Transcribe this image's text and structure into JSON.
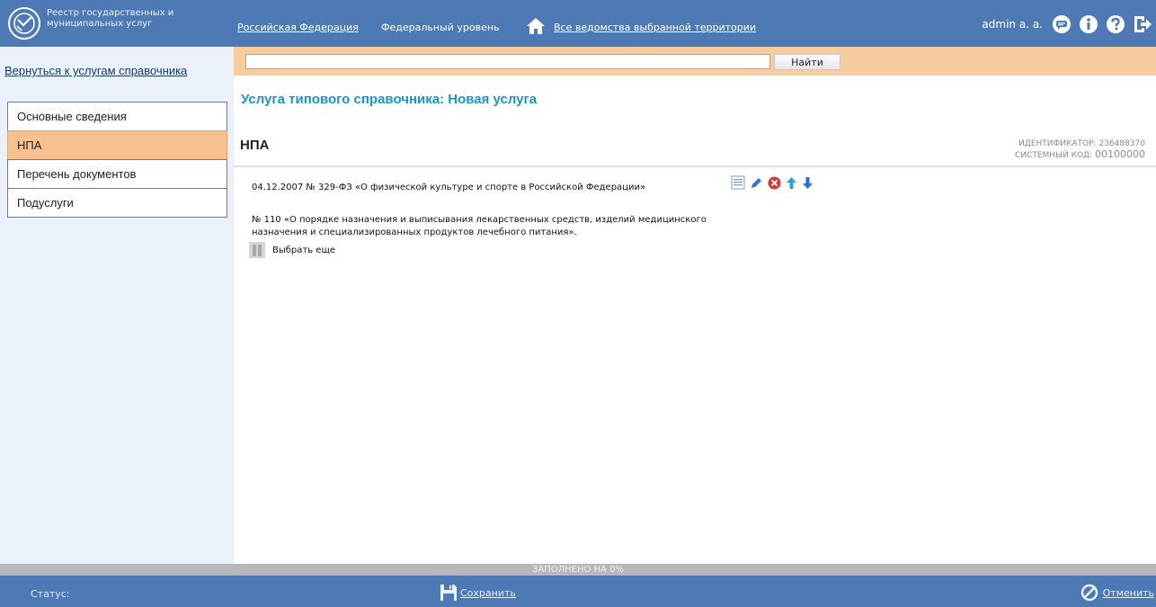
{
  "header": {
    "logo_text": [
      "Реестр государственных и",
      "муниципальных услуг"
    ],
    "region_link": "Российская Федерация",
    "level_label": "Федеральный уровень",
    "departments_link": "Все ведомства выбранной территории",
    "user_name": "admin a. a.",
    "icons": [
      "home-icon",
      "chat-icon",
      "info-icon",
      "help-icon",
      "logout-icon"
    ]
  },
  "sidebar": {
    "back_link": "Вернуться к услугам справочника",
    "items": [
      {
        "label": "Основные сведения",
        "active": false
      },
      {
        "label": "НПА",
        "active": true
      },
      {
        "label": "Перечень документов",
        "active": false
      },
      {
        "label": "Подуслуги",
        "active": false
      }
    ]
  },
  "search": {
    "value": "",
    "button_label": "Найти"
  },
  "main": {
    "page_title": "Услуга типового  справочника: Новая услуга",
    "section_title": "НПА",
    "identifier_label": "ИДЕНТИФИКАТОР:",
    "identifier_value": "236488370",
    "system_code_label": "СИСТЕМНЫЙ КОД:",
    "system_code_value": "00100000",
    "documents": [
      "04.12.2007 № 329-ФЗ «О физической культуре и спорте в Российской Федерации»",
      "№ 110 «О порядке назначения и выписывания лекарственных средств, изделий медицинского назначения и специализированных продуктов лечебного питания»."
    ],
    "select_more_label": "Выбрать еще"
  },
  "footer": {
    "progress_text": "ЗАПОЛНЕНО НА 0%",
    "progress_percent": 0,
    "status_label": "Статус:",
    "save_label": "Сохранить",
    "cancel_label": "Отменить"
  },
  "colors": {
    "header_bg": "#4d7ab5",
    "search_bar_bg": "#f9cca0",
    "active_menu_bg": "#f6c08f",
    "sidebar_bg": "#eaf1fb",
    "title_color": "#1a93c9"
  }
}
